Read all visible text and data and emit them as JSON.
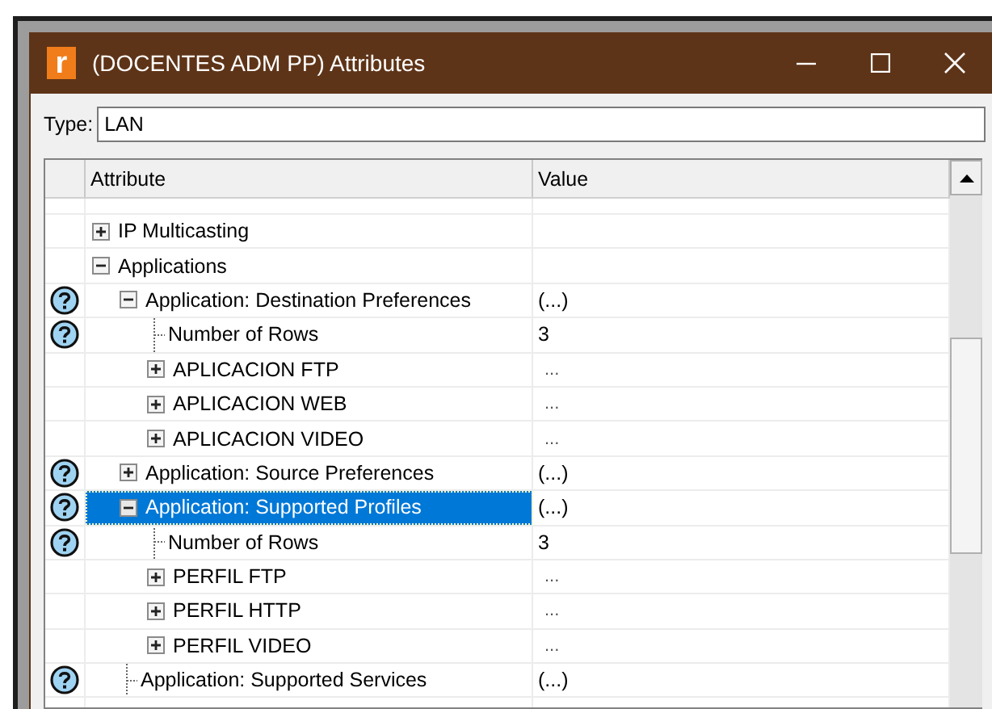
{
  "window": {
    "app_icon": "r",
    "title": "(DOCENTES ADM PP) Attributes"
  },
  "type_field": {
    "label": "Type:",
    "value": "LAN"
  },
  "table": {
    "columns": [
      "Attribute",
      "Value"
    ],
    "rows": [
      {
        "label": "IP Multicasting",
        "value": "",
        "help": false,
        "expanded": false,
        "selected": false
      },
      {
        "label": "Applications",
        "value": "",
        "help": false,
        "expanded": true,
        "selected": false,
        "children": [
          {
            "label": "Application: Destination Preferences",
            "value": "(...)",
            "help": true,
            "expanded": true,
            "selected": false,
            "children": [
              {
                "label": "Number of Rows",
                "value": "3",
                "help": true,
                "selected": false
              },
              {
                "label": "APLICACION FTP",
                "value": "...",
                "help": false,
                "expanded": false,
                "selected": false
              },
              {
                "label": "APLICACION WEB",
                "value": "...",
                "help": false,
                "expanded": false,
                "selected": false
              },
              {
                "label": "APLICACION VIDEO",
                "value": "...",
                "help": false,
                "expanded": false,
                "selected": false
              }
            ]
          },
          {
            "label": "Application: Source Preferences",
            "value": "(...)",
            "help": true,
            "expanded": false,
            "selected": false
          },
          {
            "label": "Application: Supported Profiles",
            "value": "(...)",
            "help": true,
            "expanded": true,
            "selected": true,
            "children": [
              {
                "label": "Number of Rows",
                "value": "3",
                "help": true,
                "selected": false
              },
              {
                "label": "PERFIL FTP",
                "value": "...",
                "help": false,
                "expanded": false,
                "selected": false
              },
              {
                "label": "PERFIL HTTP",
                "value": "...",
                "help": false,
                "expanded": false,
                "selected": false
              },
              {
                "label": "PERFIL VIDEO",
                "value": "...",
                "help": false,
                "expanded": false,
                "selected": false
              }
            ]
          },
          {
            "label": "Application: Supported Services",
            "value": "(...)",
            "help": true,
            "selected": false
          }
        ]
      }
    ]
  }
}
